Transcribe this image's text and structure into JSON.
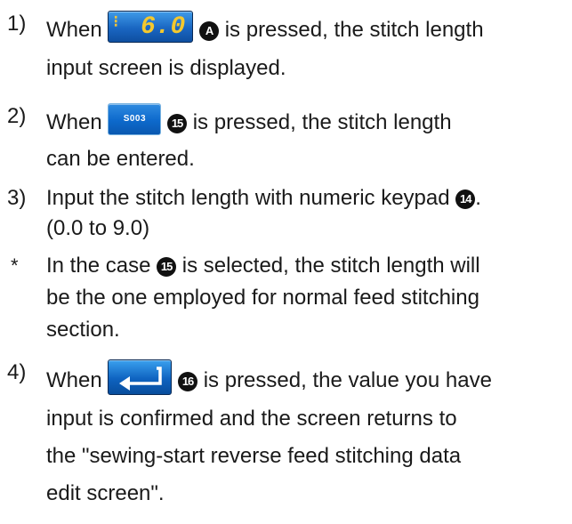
{
  "steps": [
    {
      "num": "1)",
      "pre": "When",
      "post": "is pressed, the stitch length",
      "cont": [
        "input screen is displayed."
      ],
      "marker": "A",
      "button": {
        "symbol": "⁝",
        "value": "6.0"
      }
    },
    {
      "num": "2)",
      "pre": "When",
      "post": "is pressed, the stitch length",
      "cont": [
        "can be entered."
      ],
      "marker": "15",
      "button": {
        "code": "S003"
      }
    },
    {
      "num": "3)",
      "text": "Input the stitch length with numeric keypad",
      "marker": "14",
      "tail": ".",
      "cont": [
        "(0.0 to 9.0)"
      ]
    },
    {
      "num": "4)",
      "pre": "When",
      "post": "is pressed, the value you have",
      "marker": "16",
      "cont": [
        "input is confirmed and the screen returns to",
        "the \"sewing-start reverse feed stitching data",
        "edit screen\"."
      ]
    }
  ],
  "note": {
    "star": "*",
    "pre": "In the case",
    "marker": "15",
    "post": "is selected, the stitch length will",
    "cont": [
      "be the one employed for normal feed stitching",
      "section."
    ]
  }
}
